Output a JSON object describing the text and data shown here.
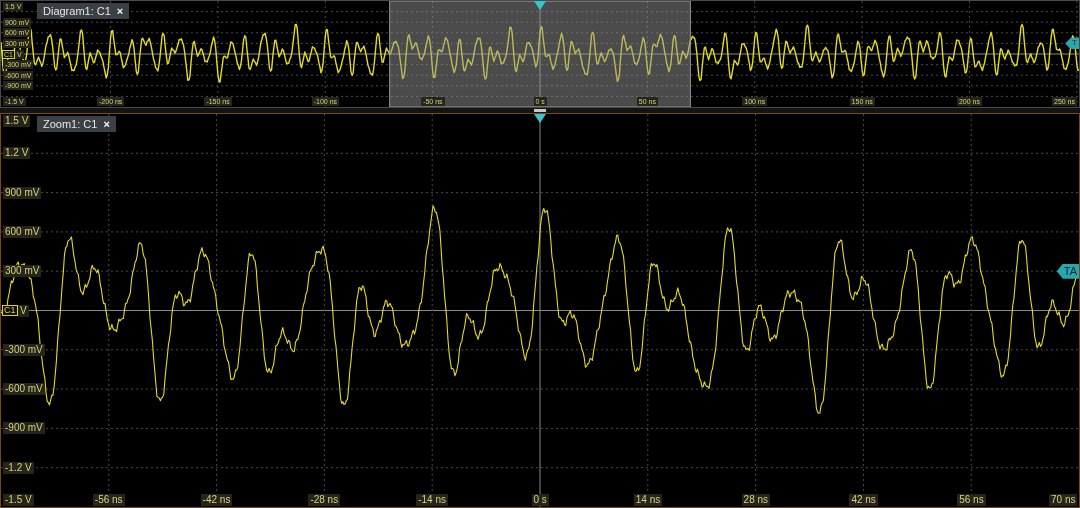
{
  "panels": [
    {
      "kind": "overview",
      "tab": {
        "title": "Diagram1: C1",
        "close": "×"
      },
      "y_labels": [
        "1.5 V",
        "900 mV",
        "600 mV",
        "300 mV",
        "V",
        "-300 mV",
        "-600 mV",
        "-900 mV",
        "-1.5 V"
      ],
      "x_labels": [
        "-200 ns",
        "-150 ns",
        "-100 ns",
        "-50 ns",
        "0 s",
        "50 ns",
        "100 ns",
        "150 ns",
        "200 ns",
        "250 ns"
      ],
      "channel_marker": "C1",
      "trigger_level": "T"
    },
    {
      "kind": "zoom",
      "tab": {
        "title": "Zoom1: C1",
        "close": "×"
      },
      "y_labels": [
        "1.5 V",
        "1.2 V",
        "900 mV",
        "600 mV",
        "300 mV",
        "V",
        "-300 mV",
        "-600 mV",
        "-900 mV",
        "-1.2 V",
        "-1.5 V"
      ],
      "x_labels": [
        "-56 ns",
        "-42 ns",
        "-28 ns",
        "-14 ns",
        "0 s",
        "14 ns",
        "28 ns",
        "42 ns",
        "56 ns",
        "70 ns"
      ],
      "channel_marker": "C1",
      "trigger_level": "TA"
    }
  ]
}
